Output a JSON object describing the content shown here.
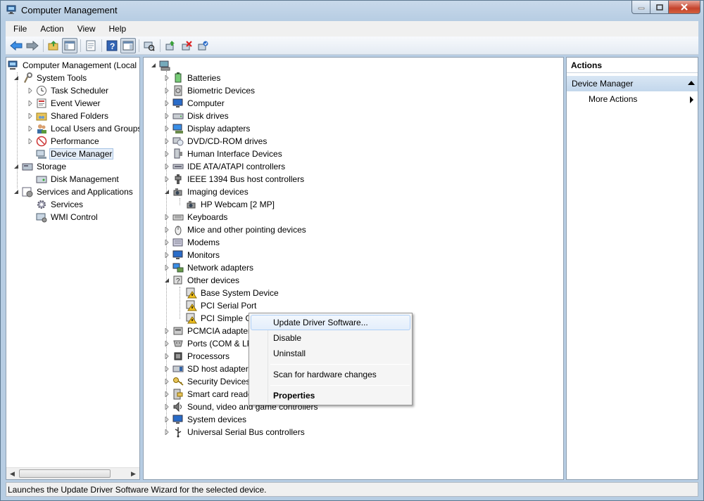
{
  "window": {
    "title": "Computer Management"
  },
  "menubar": {
    "items": [
      "File",
      "Action",
      "View",
      "Help"
    ]
  },
  "left_tree": {
    "root": "Computer Management (Local",
    "system_tools": "System Tools",
    "task_scheduler": "Task Scheduler",
    "event_viewer": "Event Viewer",
    "shared_folders": "Shared Folders",
    "local_users": "Local Users and Groups",
    "performance": "Performance",
    "device_manager": "Device Manager",
    "storage": "Storage",
    "disk_management": "Disk Management",
    "services_apps": "Services and Applications",
    "services": "Services",
    "wmi": "WMI Control"
  },
  "devices": [
    "Batteries",
    "Biometric Devices",
    "Computer",
    "Disk drives",
    "Display adapters",
    "DVD/CD-ROM drives",
    "Human Interface Devices",
    "IDE ATA/ATAPI controllers",
    "IEEE 1394 Bus host controllers",
    "Imaging devices",
    "HP Webcam [2 MP]",
    "Keyboards",
    "Mice and other pointing devices",
    "Modems",
    "Monitors",
    "Network adapters",
    "Other devices",
    "Base System Device",
    "PCI Serial Port",
    "PCI Simple C",
    "PCMCIA adapter",
    "Ports (COM & LP",
    "Processors",
    "SD host adapters",
    "Security Devices",
    "Smart card reade",
    "Sound, video and game controllers",
    "System devices",
    "Universal Serial Bus controllers"
  ],
  "actions": {
    "header": "Actions",
    "section": "Device Manager",
    "more": "More Actions"
  },
  "context_menu": {
    "update": "Update Driver Software...",
    "disable": "Disable",
    "uninstall": "Uninstall",
    "scan": "Scan for hardware changes",
    "properties": "Properties"
  },
  "status": {
    "text": "Launches the Update Driver Software Wizard for the selected device."
  }
}
